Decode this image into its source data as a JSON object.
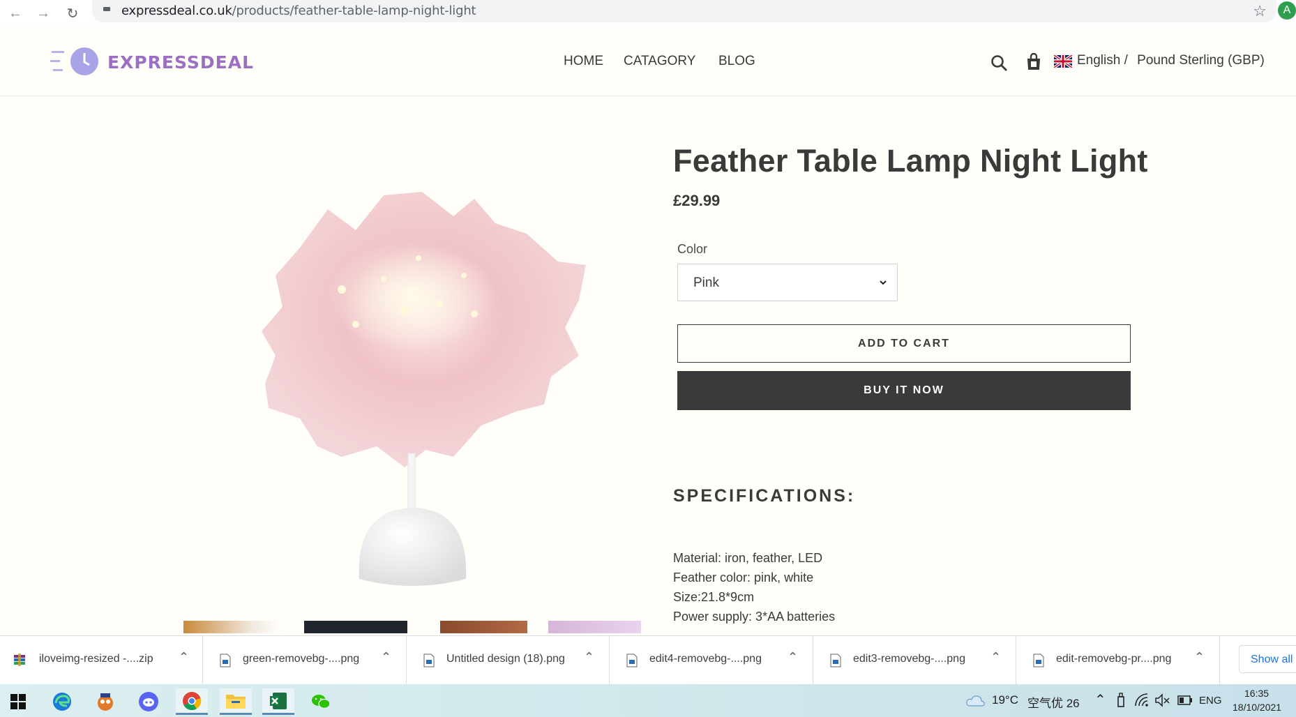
{
  "browser": {
    "url_domain": "expressdeal.co.uk",
    "url_path": "/products/feather-table-lamp-night-light",
    "profile_initial": "A"
  },
  "header": {
    "logo_text": "EXPRESSDEAL",
    "nav": [
      "HOME",
      "CATAGORY",
      "BLOG"
    ],
    "language": "English /",
    "currency": "Pound Sterling (GBP)"
  },
  "product": {
    "title": "Feather Table Lamp Night Light",
    "price": "£29.99",
    "color_label": "Color",
    "color_selected": "Pink",
    "add_to_cart": "ADD TO CART",
    "buy_now": "BUY IT NOW",
    "specs_heading": "SPECIFICATIONS:",
    "specs": [
      "Material: iron, feather, LED",
      "Feather color: pink, white",
      "Size:21.8*9cm",
      "Power supply: 3*AA batteries"
    ]
  },
  "downloads": {
    "items": [
      "iloveimg-resized -....zip",
      "green-removebg-....png",
      "Untitled design (18).png",
      "edit4-removebg-....png",
      "edit3-removebg-....png",
      "edit-removebg-pr....png"
    ],
    "show_all": "Show all"
  },
  "taskbar": {
    "weather": "19°C",
    "air_quality": "空气优 26",
    "ime": "ENG",
    "time": "16:35",
    "date": "18/10/2021"
  }
}
